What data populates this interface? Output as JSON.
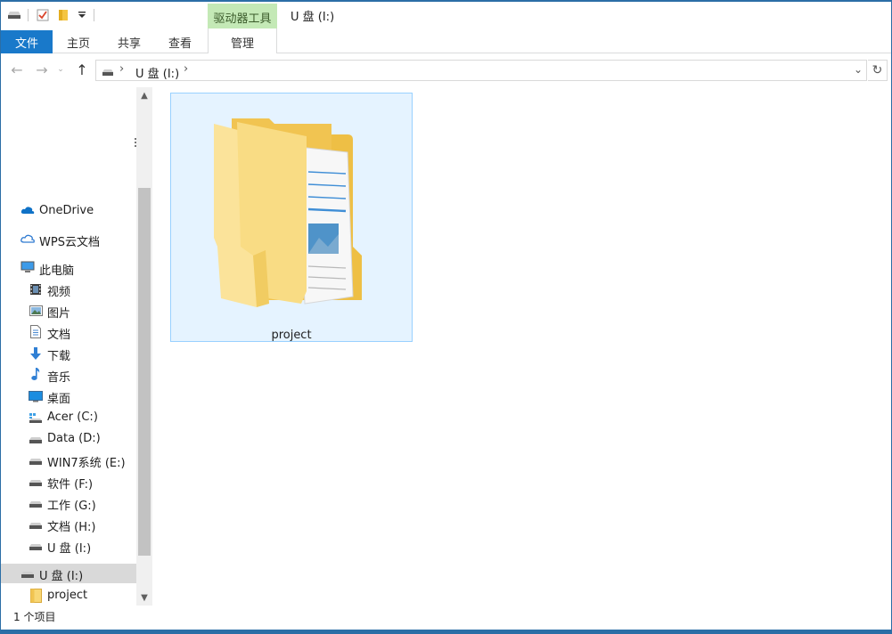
{
  "window": {
    "title": "U 盘 (I:)",
    "contextual_tab_group": "驱动器工具"
  },
  "ribbon": {
    "tabs": [
      {
        "label": "文件"
      },
      {
        "label": "主页"
      },
      {
        "label": "共享"
      },
      {
        "label": "查看"
      },
      {
        "label": "管理"
      }
    ]
  },
  "address_bar": {
    "path_segment": "U 盘 (I:)"
  },
  "nav_pane": {
    "quick_items": [
      {
        "label": "OneDrive",
        "icon": "onedrive-icon"
      },
      {
        "label": "WPS云文档",
        "icon": "cloud-icon"
      }
    ],
    "this_pc": {
      "label": "此电脑",
      "icon": "computer-icon"
    },
    "pc_items": [
      {
        "label": "视频",
        "icon": "video-icon"
      },
      {
        "label": "图片",
        "icon": "pictures-icon"
      },
      {
        "label": "文档",
        "icon": "documents-icon"
      },
      {
        "label": "下载",
        "icon": "download-icon"
      },
      {
        "label": "音乐",
        "icon": "music-icon"
      },
      {
        "label": "桌面",
        "icon": "desktop-icon"
      },
      {
        "label": "Acer (C:)",
        "icon": "system-drive-icon"
      },
      {
        "label": "Data (D:)",
        "icon": "drive-icon"
      },
      {
        "label": "WIN7系统 (E:)",
        "icon": "drive-icon"
      },
      {
        "label": "软件 (F:)",
        "icon": "drive-icon"
      },
      {
        "label": "工作 (G:)",
        "icon": "drive-icon"
      },
      {
        "label": "文档 (H:)",
        "icon": "drive-icon"
      },
      {
        "label": "U 盘 (I:)",
        "icon": "drive-icon"
      }
    ],
    "usb_root": {
      "label": "U 盘 (I:)",
      "icon": "drive-icon"
    },
    "usb_children": [
      {
        "label": "project",
        "icon": "folder-icon"
      }
    ]
  },
  "content": {
    "items": [
      {
        "name": "project",
        "icon": "folder-icon"
      }
    ]
  },
  "status_bar": {
    "item_count": "1 个项目"
  },
  "colors": {
    "accent": "#1979ca",
    "contextual_tab": "#c4e9b6",
    "selection_fill": "#e5f3ff",
    "selection_border": "#99d1ff",
    "nav_selected": "#d9d9d9"
  }
}
